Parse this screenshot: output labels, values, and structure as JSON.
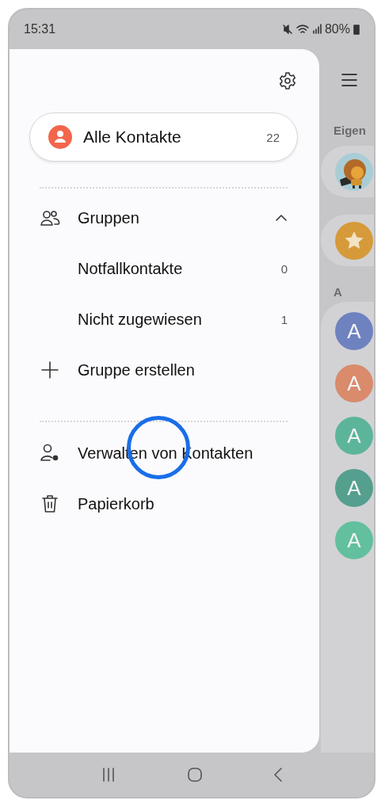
{
  "status_bar": {
    "time": "15:31",
    "battery": "80%"
  },
  "drawer": {
    "all_contacts": {
      "label": "Alle Kontakte",
      "count": "22"
    },
    "groups": {
      "label": "Gruppen",
      "expanded": true,
      "children": [
        {
          "label": "Notfallkontakte",
          "count": "0"
        },
        {
          "label": "Nicht zugewiesen",
          "count": "1"
        }
      ]
    },
    "actions": [
      {
        "kind": "create",
        "label": "Gruppe erstellen"
      },
      {
        "kind": "manage",
        "label": "Verwalten von Kontakten"
      },
      {
        "kind": "trash",
        "label": "Papierkorb"
      }
    ]
  },
  "background_list": {
    "section_label": "Eigen",
    "index_letter": "A",
    "contacts": [
      {
        "initial": "A",
        "color": "#6f82c0"
      },
      {
        "initial": "A",
        "color": "#d98b6c"
      },
      {
        "initial": "A",
        "color": "#5cb59a"
      },
      {
        "initial": "A",
        "color": "#559f8f"
      },
      {
        "initial": "A",
        "color": "#62c09e"
      }
    ]
  }
}
